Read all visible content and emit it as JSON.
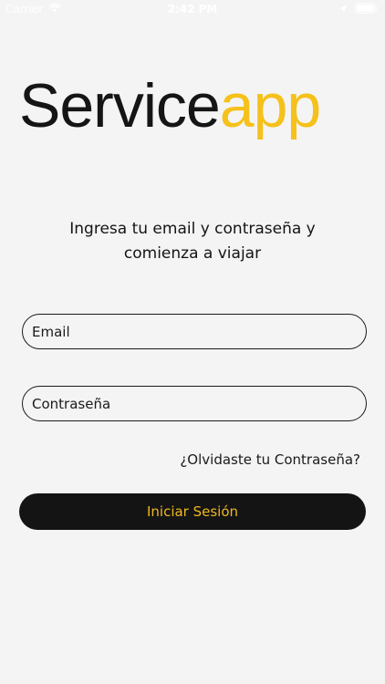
{
  "status_bar": {
    "carrier": "Carrier",
    "time": "2:42 PM",
    "icons": [
      "wifi-icon",
      "location-arrow-icon",
      "battery-icon"
    ]
  },
  "logo": {
    "part1": "Service",
    "part2": "app",
    "color_part1": "#151515",
    "color_part2": "#f5c11a"
  },
  "intro": {
    "line1": "Ingresa tu email y contraseña y",
    "line2": "comienza a viajar"
  },
  "form": {
    "email_placeholder": "Email",
    "email_value": "",
    "password_placeholder": "Contraseña",
    "password_value": "",
    "forgot_label": "¿Olvidaste tu Contraseña?",
    "submit_label": "Iniciar Sesión"
  },
  "colors": {
    "background": "#f4f4f4",
    "button_bg": "#141414",
    "button_text": "#f0b820"
  }
}
